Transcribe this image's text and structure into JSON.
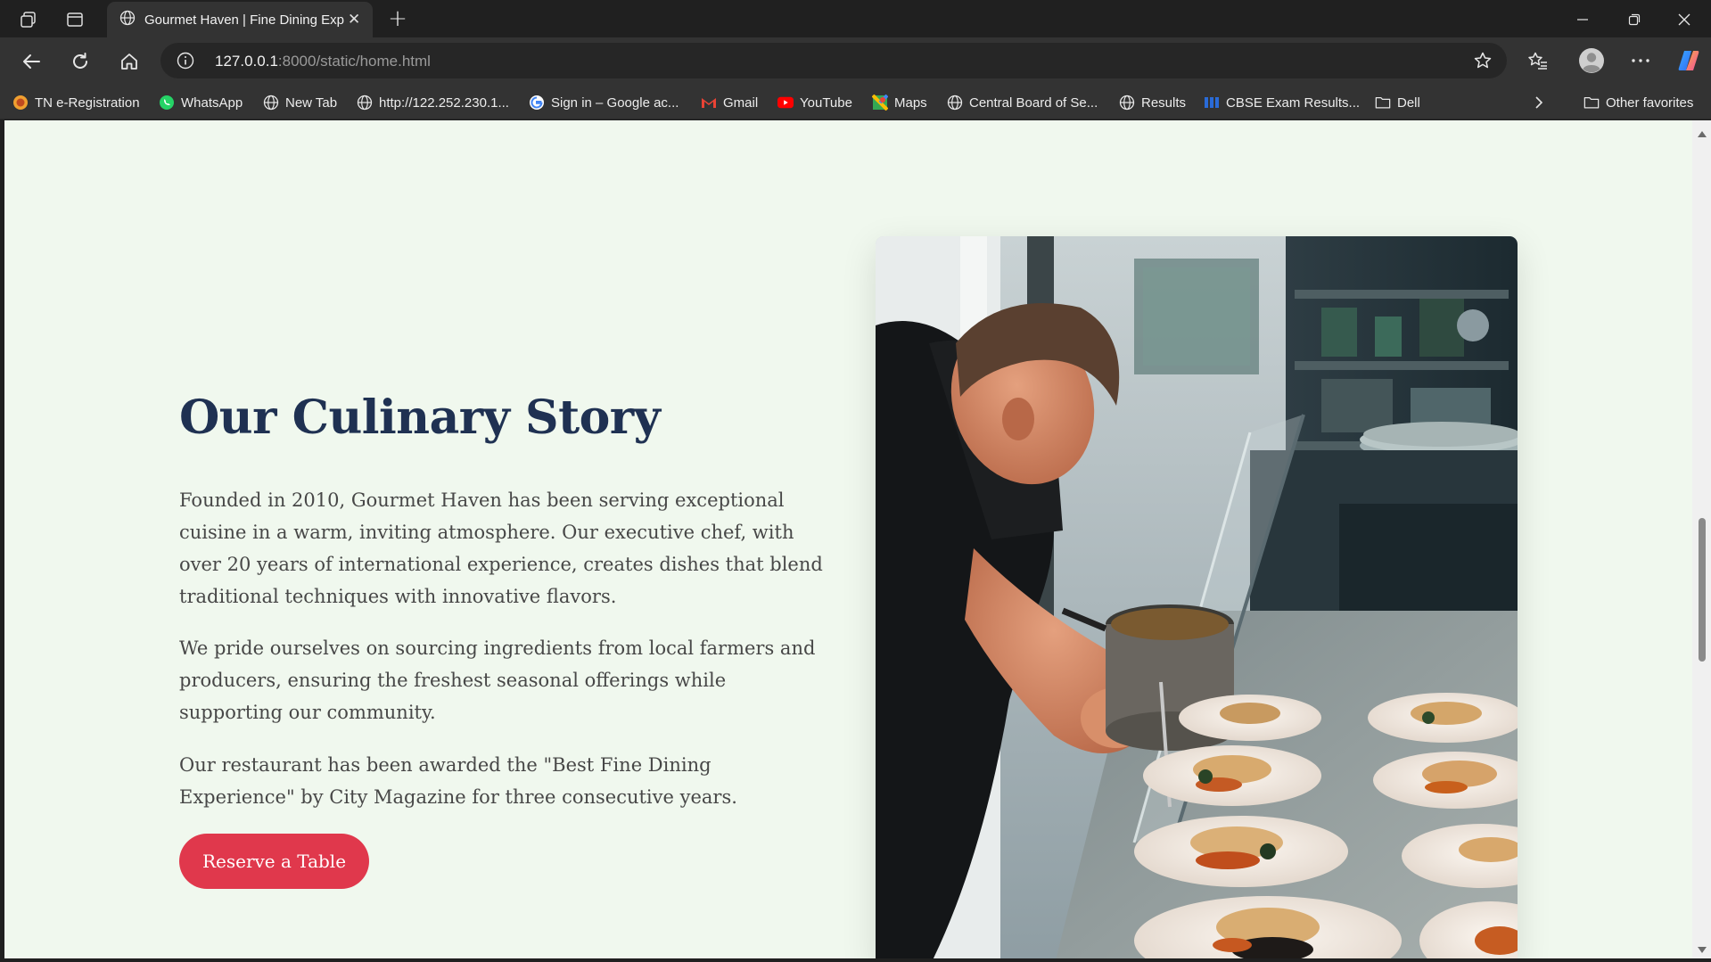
{
  "browser": {
    "tab": {
      "title": "Gourmet Haven | Fine Dining Experience",
      "favicon": "globe-icon"
    },
    "url": {
      "host": "127.0.0.1",
      "rest": ":8000/static/home.html"
    },
    "bookmarks": [
      {
        "label": "TN e-Registration",
        "icon": "tn-logo-icon"
      },
      {
        "label": "WhatsApp",
        "icon": "whatsapp-icon"
      },
      {
        "label": "New Tab",
        "icon": "globe-icon"
      },
      {
        "label": "http://122.252.230.1...",
        "icon": "globe-icon"
      },
      {
        "label": "Sign in – Google ac...",
        "icon": "google-icon"
      },
      {
        "label": "Gmail",
        "icon": "gmail-icon"
      },
      {
        "label": "YouTube",
        "icon": "youtube-icon"
      },
      {
        "label": "Maps",
        "icon": "maps-icon"
      },
      {
        "label": "Central Board of Se...",
        "icon": "globe-icon"
      },
      {
        "label": "Results",
        "icon": "globe-icon"
      },
      {
        "label": "CBSE Exam Results...",
        "icon": "cbse-icon"
      },
      {
        "label": "Dell",
        "icon": "folder-icon"
      }
    ],
    "other_favorites": "Other favorites"
  },
  "page": {
    "title": "Our Culinary Story",
    "paragraphs": [
      "Founded in 2010, Gourmet Haven has been serving exceptional cuisine in a warm, inviting atmosphere. Our executive chef, with over 20 years of international experience, creates dishes that blend traditional techniques with innovative flavors.",
      "We pride ourselves on sourcing ingredients from local farmers and producers, ensuring the freshest seasonal offerings while supporting our community.",
      "Our restaurant has been awarded the \"Best Fine Dining Experience\" by City Magazine for three consecutive years."
    ],
    "cta": "Reserve a Table",
    "image_subject": "chef-plating-dishes-photo"
  },
  "colors": {
    "page_bg": "#f0f8ee",
    "heading": "#1f3152",
    "body_text": "#474747",
    "accent": "#e0384c"
  }
}
